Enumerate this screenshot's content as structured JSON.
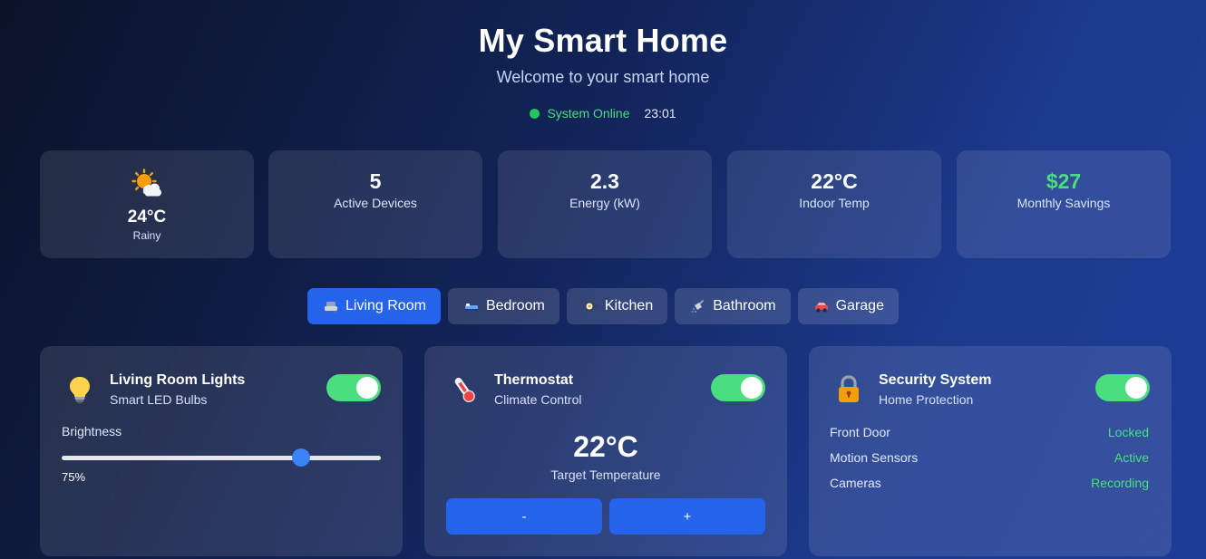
{
  "header": {
    "title": "My Smart Home",
    "subtitle": "Welcome to your smart home",
    "status_text": "System Online",
    "time": "23:01"
  },
  "stats": {
    "weather": {
      "icon": "sun-behind-cloud-icon",
      "temp": "24°C",
      "condition": "Rainy"
    },
    "active_devices": {
      "value": "5",
      "label": "Active Devices"
    },
    "energy": {
      "value": "2.3",
      "label": "Energy (kW)"
    },
    "indoor_temp": {
      "value": "22°C",
      "label": "Indoor Temp"
    },
    "savings": {
      "value": "$27",
      "label": "Monthly Savings"
    }
  },
  "tabs": [
    {
      "label": "Living Room",
      "icon": "couch-icon",
      "active": true
    },
    {
      "label": "Bedroom",
      "icon": "bed-icon",
      "active": false
    },
    {
      "label": "Kitchen",
      "icon": "cooking-icon",
      "active": false
    },
    {
      "label": "Bathroom",
      "icon": "shower-icon",
      "active": false
    },
    {
      "label": "Garage",
      "icon": "car-icon",
      "active": false
    }
  ],
  "lights": {
    "icon": "lightbulb-icon",
    "title": "Living Room Lights",
    "subtitle": "Smart LED Bulbs",
    "on": true,
    "brightness_label": "Brightness",
    "brightness": 75,
    "brightness_text": "75%"
  },
  "thermostat": {
    "icon": "thermometer-icon",
    "title": "Thermostat",
    "subtitle": "Climate Control",
    "on": true,
    "temp": "22°C",
    "temp_label": "Target Temperature",
    "minus_label": "-",
    "plus_label": "+"
  },
  "security": {
    "icon": "lock-icon",
    "title": "Security System",
    "subtitle": "Home Protection",
    "on": true,
    "rows": [
      {
        "label": "Front Door",
        "value": "Locked"
      },
      {
        "label": "Motion Sensors",
        "value": "Active"
      },
      {
        "label": "Cameras",
        "value": "Recording"
      }
    ]
  },
  "colors": {
    "accent": "#2563eb",
    "online": "#22c55e",
    "positive": "#4ade80"
  }
}
